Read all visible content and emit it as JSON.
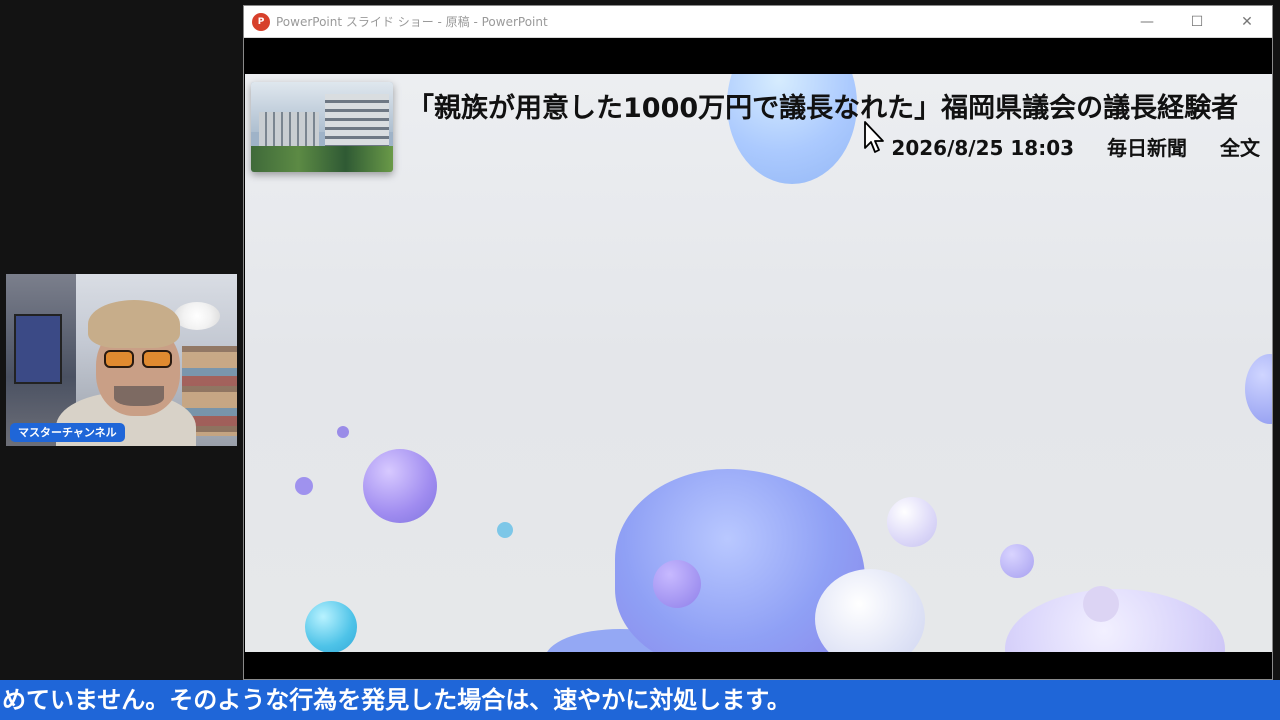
{
  "webcam": {
    "name_tag": "マスターチャンネル"
  },
  "window": {
    "title": "PowerPoint スライド ショー - 原稿 - PowerPoint",
    "app_icon": "powerpoint-icon",
    "controls": {
      "minimize": "—",
      "maximize": "☐",
      "close": "✕"
    }
  },
  "slide": {
    "headline": "「親族が用意した1000万円で議長なれた」福岡県議会の議長経験者",
    "datetime": "2026/8/25 18:03",
    "source": "毎日新聞",
    "fulltext": "全文"
  },
  "caption": {
    "text": "めていません。そのような行為を発見した場合は、速やかに対処します。"
  },
  "colors": {
    "caption_bg": "#1f66d8",
    "name_tag_bg": "#1f66d8",
    "background": "#131313"
  }
}
